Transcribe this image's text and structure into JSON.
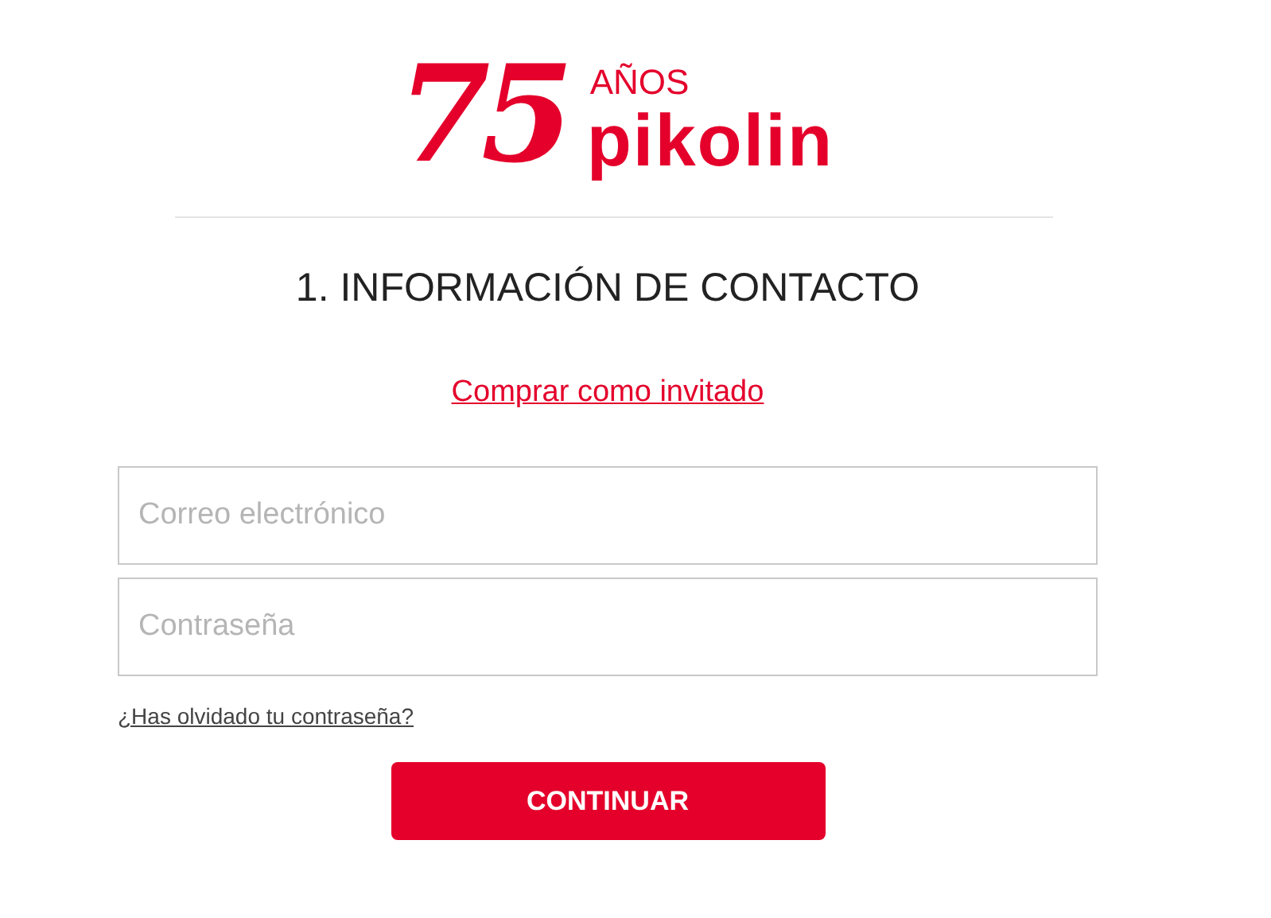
{
  "logo": {
    "number": "75",
    "years": "AÑOS",
    "brand": "pikolin"
  },
  "heading": "1. INFORMACIÓN DE CONTACTO",
  "guest_link": "Comprar como invitado",
  "fields": [
    {
      "placeholder": "Correo electrónico"
    },
    {
      "placeholder": "Contraseña"
    }
  ],
  "forgot_link": "¿Has olvidado tu contraseña?",
  "submit": "CONTINUAR"
}
